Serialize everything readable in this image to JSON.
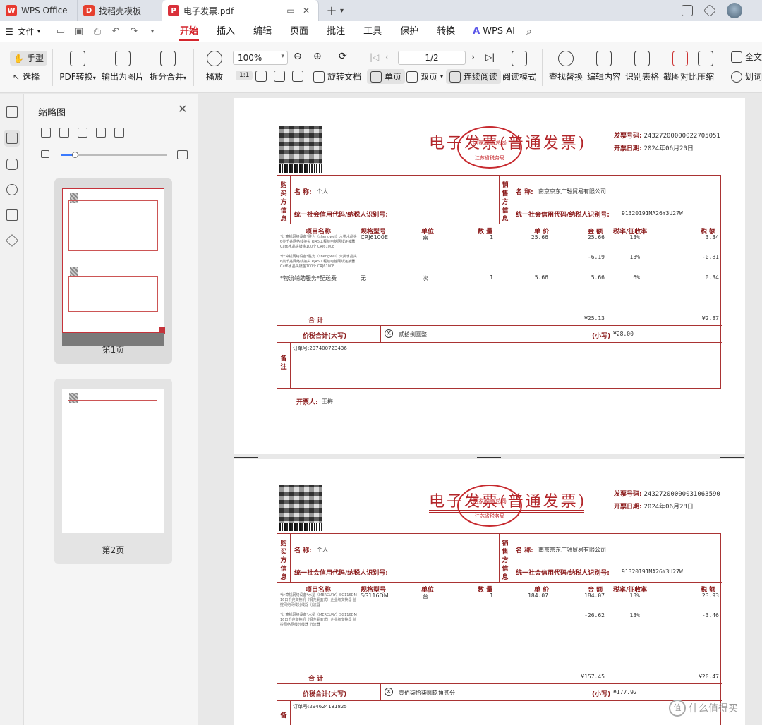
{
  "tabs": [
    {
      "label": "WPS Office",
      "icon": "wps-logo-icon"
    },
    {
      "label": "找稻壳模板",
      "icon": "docer-logo-icon"
    },
    {
      "label": "电子发票.pdf",
      "icon": "pdf-file-icon",
      "active": true
    }
  ],
  "menu": {
    "file_label": "文件",
    "items": [
      "开始",
      "插入",
      "编辑",
      "页面",
      "批注",
      "工具",
      "保护",
      "转换"
    ],
    "active": "开始",
    "ai_label": "WPS AI"
  },
  "ribbon": {
    "hand": "手型",
    "select": "选择",
    "pdf_convert": "PDF转换",
    "export_image": "输出为图片",
    "split_merge": "拆分合并",
    "play": "播放",
    "zoom": "100%",
    "page": "1/2",
    "rotate": "旋转文档",
    "single": "单页",
    "double": "双页",
    "continuous": "连续阅读",
    "read_mode": "阅读模式",
    "find_replace": "查找替换",
    "edit_content": "编辑内容",
    "recognize_table": "识别表格",
    "screenshot_compare": "截图对比",
    "compress": "压缩",
    "full_text": "全文",
    "word_translate": "划词"
  },
  "thumbs": {
    "title": "缩略图",
    "pages": [
      "第1页",
      "第2页"
    ]
  },
  "colors": {
    "accent": "#d4262d",
    "invoice_red": "#8b1b1b"
  },
  "invoices": [
    {
      "title": "电子发票(普通发票)",
      "seal_top": "国家税务总局",
      "seal_bottom": "江苏省税务局",
      "invoice_no_label": "发票号码:",
      "invoice_no": "24327200000022705051",
      "date_label": "开票日期:",
      "date": "2024年06月20日",
      "buyer_side": "购买方信息",
      "seller_side": "销售方信息",
      "name_label": "名 称:",
      "buyer_name": "个人",
      "seller_name": "南京京东广融贸易有限公司",
      "tax_label": "统一社会信用代码/纳税人识别号:",
      "seller_tax": "91320191MA26Y3U27W",
      "headers": [
        "项目名称",
        "规格型号",
        "单位",
        "数 量",
        "单 价",
        "金 额",
        "税率/征收率",
        "税 额"
      ],
      "rows": [
        {
          "name": "*计算机网络设备*胜为（shengwei）六类水晶头 6类千兆网络线接头 RJ45工程级电脑网线连接器 Cat6水晶头镀金100个 CRJ6100E",
          "model": "CRJ6100E",
          "unit": "盒",
          "qty": "1",
          "price": "25.66",
          "amount": "25.66",
          "rate": "13%",
          "tax": "3.34"
        },
        {
          "name": "*计算机网络设备*胜为（shengwei）六类水晶头 6类千兆网络线接头 RJ45工程级电脑网线连接器 Cat6水晶头镀金100个 CRJ6100E",
          "model": "",
          "unit": "",
          "qty": "",
          "price": "",
          "amount": "-6.19",
          "rate": "13%",
          "tax": "-0.81"
        },
        {
          "name": "*物流辅助服务*配送费",
          "model": "无",
          "unit": "次",
          "qty": "1",
          "price": "5.66",
          "amount": "5.66",
          "rate": "6%",
          "tax": "0.34"
        }
      ],
      "total_label": "合 计",
      "total_amount": "¥25.13",
      "total_tax": "¥2.87",
      "grand_label": "价税合计(大写)",
      "grand_words": "贰拾捌圆整",
      "small_label": "(小写)",
      "grand_small": "¥28.00",
      "remark_side": "备注",
      "order_no": "订单号:297400723436",
      "issuer_label": "开票人:",
      "issuer": "王梅"
    },
    {
      "title": "电子发票(普通发票)",
      "seal_top": "国家税务总局",
      "seal_bottom": "江苏省税务局",
      "invoice_no_label": "发票号码:",
      "invoice_no": "24327200000031063590",
      "date_label": "开票日期:",
      "date": "2024年06月28日",
      "buyer_side": "购买方信息",
      "seller_side": "销售方信息",
      "name_label": "名 称:",
      "buyer_name": "个人",
      "seller_name": "南京京东广融贸易有限公司",
      "tax_label": "统一社会信用代码/纳税人识别号:",
      "seller_tax": "91320191MA26Y3U27W",
      "headers": [
        "项目名称",
        "规格型号",
        "单位",
        "数 量",
        "单 价",
        "金 额",
        "税率/征收率",
        "税 额"
      ],
      "rows": [
        {
          "name": "*计算机网络设备*水星（MERCURY）SG116DM 16口千兆交换机（钢壳桌面式）企业级交换器 监控网络网线分线器 分流器",
          "model": "SG116DM",
          "unit": "台",
          "qty": "1",
          "price": "184.07",
          "amount": "184.07",
          "rate": "13%",
          "tax": "23.93"
        },
        {
          "name": "*计算机网络设备*水星（MERCURY）SG116DM 16口千兆交换机（钢壳桌面式）企业级交换器 监控网络网线分线器 分流器",
          "model": "",
          "unit": "",
          "qty": "",
          "price": "",
          "amount": "-26.62",
          "rate": "13%",
          "tax": "-3.46"
        }
      ],
      "total_label": "合 计",
      "total_amount": "¥157.45",
      "total_tax": "¥20.47",
      "grand_label": "价税合计(大写)",
      "grand_words": "壹佰柒拾柒圆玖角贰分",
      "small_label": "(小写)",
      "grand_small": "¥177.92",
      "remark_side": "备",
      "order_no": "订单号:294624131825"
    }
  ],
  "watermark": "什么值得买"
}
